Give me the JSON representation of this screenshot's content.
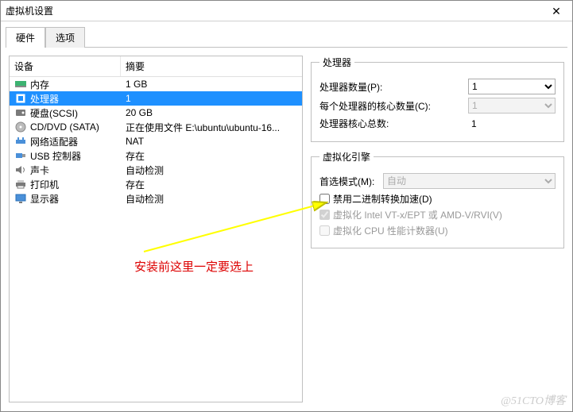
{
  "window": {
    "title": "虚拟机设置"
  },
  "tabs": {
    "hardware": "硬件",
    "options": "选项"
  },
  "list": {
    "header": {
      "device": "设备",
      "summary": "摘要"
    },
    "rows": [
      {
        "icon": "memory-icon",
        "name": "内存",
        "summary": "1 GB"
      },
      {
        "icon": "cpu-icon",
        "name": "处理器",
        "summary": "1"
      },
      {
        "icon": "disk-icon",
        "name": "硬盘(SCSI)",
        "summary": "20 GB"
      },
      {
        "icon": "cd-icon",
        "name": "CD/DVD (SATA)",
        "summary": "正在使用文件 E:\\ubuntu\\ubuntu-16..."
      },
      {
        "icon": "net-icon",
        "name": "网络适配器",
        "summary": "NAT"
      },
      {
        "icon": "usb-icon",
        "name": "USB 控制器",
        "summary": "存在"
      },
      {
        "icon": "sound-icon",
        "name": "声卡",
        "summary": "自动检测"
      },
      {
        "icon": "printer-icon",
        "name": "打印机",
        "summary": "存在"
      },
      {
        "icon": "display-icon",
        "name": "显示器",
        "summary": "自动检测"
      }
    ],
    "selected_index": 1
  },
  "processors": {
    "legend": "处理器",
    "count_label": "处理器数量(P):",
    "count_value": "1",
    "cores_label": "每个处理器的核心数量(C):",
    "cores_value": "1",
    "total_label": "处理器核心总数:",
    "total_value": "1"
  },
  "virt": {
    "legend": "虚拟化引擎",
    "mode_label": "首选模式(M):",
    "mode_value": "自动",
    "chk_binary": "禁用二进制转换加速(D)",
    "chk_vtx": "虚拟化 Intel VT-x/EPT 或 AMD-V/RVI(V)",
    "chk_cpu": "虚拟化 CPU 性能计数器(U)"
  },
  "annotation": "安装前这里一定要选上",
  "watermark": "@51CTO博客"
}
